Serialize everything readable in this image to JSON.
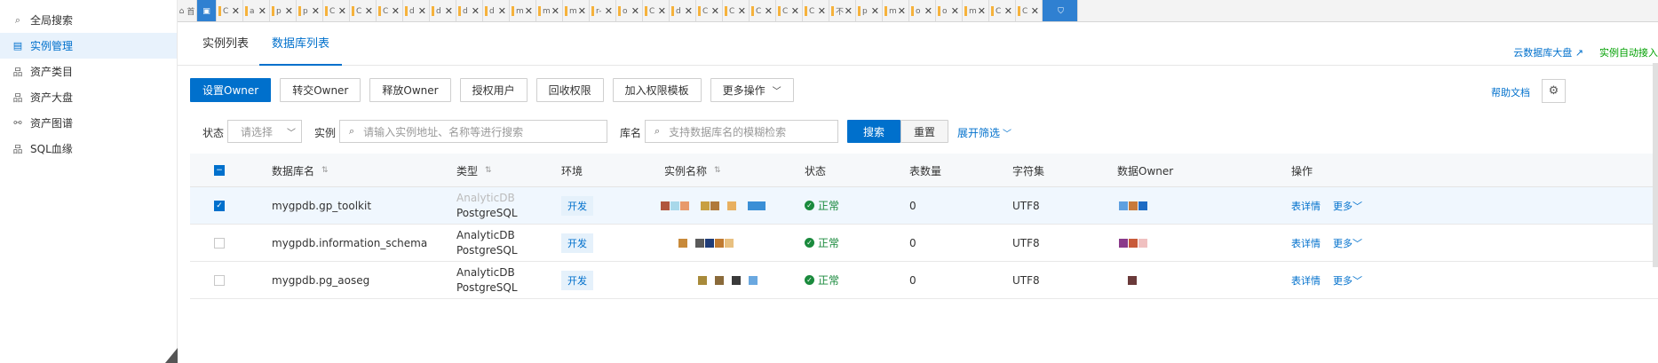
{
  "sidebar": {
    "items": [
      {
        "label": "全局搜索",
        "icon": "search-icon",
        "glyph": "⌕"
      },
      {
        "label": "实例管理",
        "icon": "instance-icon",
        "glyph": "▤"
      },
      {
        "label": "资产类目",
        "icon": "tree-icon",
        "glyph": "品"
      },
      {
        "label": "资产大盘",
        "icon": "tree-icon",
        "glyph": "品"
      },
      {
        "label": "资产图谱",
        "icon": "graph-icon",
        "glyph": "⚯"
      },
      {
        "label": "SQL血缘",
        "icon": "tree-icon",
        "glyph": "品"
      }
    ]
  },
  "tabs": {
    "home_label": "首",
    "items": [
      "C",
      "a",
      "p",
      "p",
      "C",
      "C",
      "C",
      "d",
      "d",
      "d",
      "d",
      "m",
      "m",
      "m",
      "r-",
      "o",
      "C",
      "d",
      "C",
      "C",
      "C",
      "C",
      "C",
      "不",
      "p",
      "m",
      "o",
      "o",
      "m",
      "C",
      "C"
    ]
  },
  "subtabs": {
    "instances": "实例列表",
    "databases": "数据库列表"
  },
  "toplinks": {
    "dashboard": "云数据库大盘 ↗",
    "autojoin": "实例自动接入"
  },
  "toolbar": {
    "set_owner": "设置Owner",
    "transfer_owner": "转交Owner",
    "release_owner": "释放Owner",
    "grant_user": "授权用户",
    "revoke": "回收权限",
    "add_template": "加入权限模板",
    "more_ops": "更多操作",
    "help": "帮助文档"
  },
  "filters": {
    "status_label": "状态",
    "status_placeholder": "请选择",
    "instance_label": "实例",
    "instance_placeholder": "请输入实例地址、名称等进行搜索",
    "dbname_label": "库名",
    "dbname_placeholder": "支持数据库名的模糊检索",
    "search": "搜索",
    "reset": "重置",
    "expand": "展开筛选"
  },
  "table": {
    "headers": {
      "dbname": "数据库名",
      "type": "类型",
      "env": "环境",
      "instance": "实例名称",
      "status": "状态",
      "tables": "表数量",
      "charset": "字符集",
      "owner": "数据Owner",
      "ops": "操作"
    },
    "rows": [
      {
        "dbname": "mygpdb.gp_toolkit",
        "type1": "AnalyticDB",
        "type2": "PostgreSQL",
        "env": "开发",
        "status": "正常",
        "tables": "0",
        "charset": "UTF8",
        "detail": "表详情",
        "more": "更多",
        "selected": true
      },
      {
        "dbname": "mygpdb.information_schema",
        "type1": "AnalyticDB",
        "type2": "PostgreSQL",
        "env": "开发",
        "status": "正常",
        "tables": "0",
        "charset": "UTF8",
        "detail": "表详情",
        "more": "更多",
        "selected": false
      },
      {
        "dbname": "mygpdb.pg_aoseg",
        "type1": "AnalyticDB",
        "type2": "PostgreSQL",
        "env": "开发",
        "status": "正常",
        "tables": "0",
        "charset": "UTF8",
        "detail": "表详情",
        "more": "更多",
        "selected": false
      }
    ]
  },
  "colors": {
    "primary": "#0070cc",
    "success": "#1a8a3d",
    "tab_active": "#2f80d1"
  }
}
